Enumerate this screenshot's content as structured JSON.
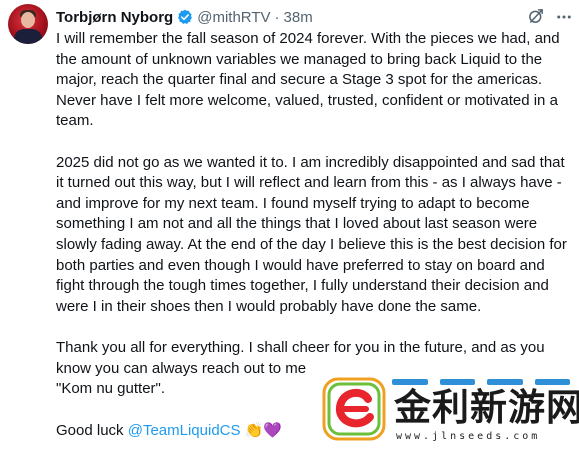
{
  "author": {
    "name": "Torbjørn Nyborg",
    "handle": "@mithRTV",
    "separator": "·",
    "time": "38m",
    "verified": true
  },
  "icons": {
    "verified": "verified-badge-icon",
    "grok": "grok-icon",
    "more": "more-icon"
  },
  "colors": {
    "text": "#0f1419",
    "secondary": "#536471",
    "accent": "#1d9bf0",
    "verified": "#1d9bf0"
  },
  "tweet": {
    "paragraphs": [
      "I will remember the fall season of 2024 forever. With the pieces we had, and the amount of unknown variables we managed to bring back Liquid to the major, reach the quarter final and secure a Stage 3 spot for the americas. Never have I felt more welcome, valued, trusted, confident or motivated in a team.",
      "2025 did not go as we wanted it to. I am incredibly disappointed and sad that it turned out this way, but I will reflect and learn from this - as I always have - and improve for my next team. I found myself trying to adapt to become something I am not and all the things that I loved about last season were slowly fading away. At the end of the day I believe this is the best decision for both parties and even though I would have preferred to stay on board and fight through the tough times together, I fully understand their decision and were I in their shoes then I would probably have done the same.",
      "Thank you all for everything. I shall cheer for you in the future, and as you know you can always reach out to me\n\"Kom nu gutter\"."
    ],
    "closing_prefix": "Good luck ",
    "mention": "@TeamLiquidCS",
    "emoji_clap": "👏",
    "emoji_heart": "💜"
  },
  "watermark": {
    "title": "金利新游网",
    "url": "www.jlnseeds.com"
  }
}
